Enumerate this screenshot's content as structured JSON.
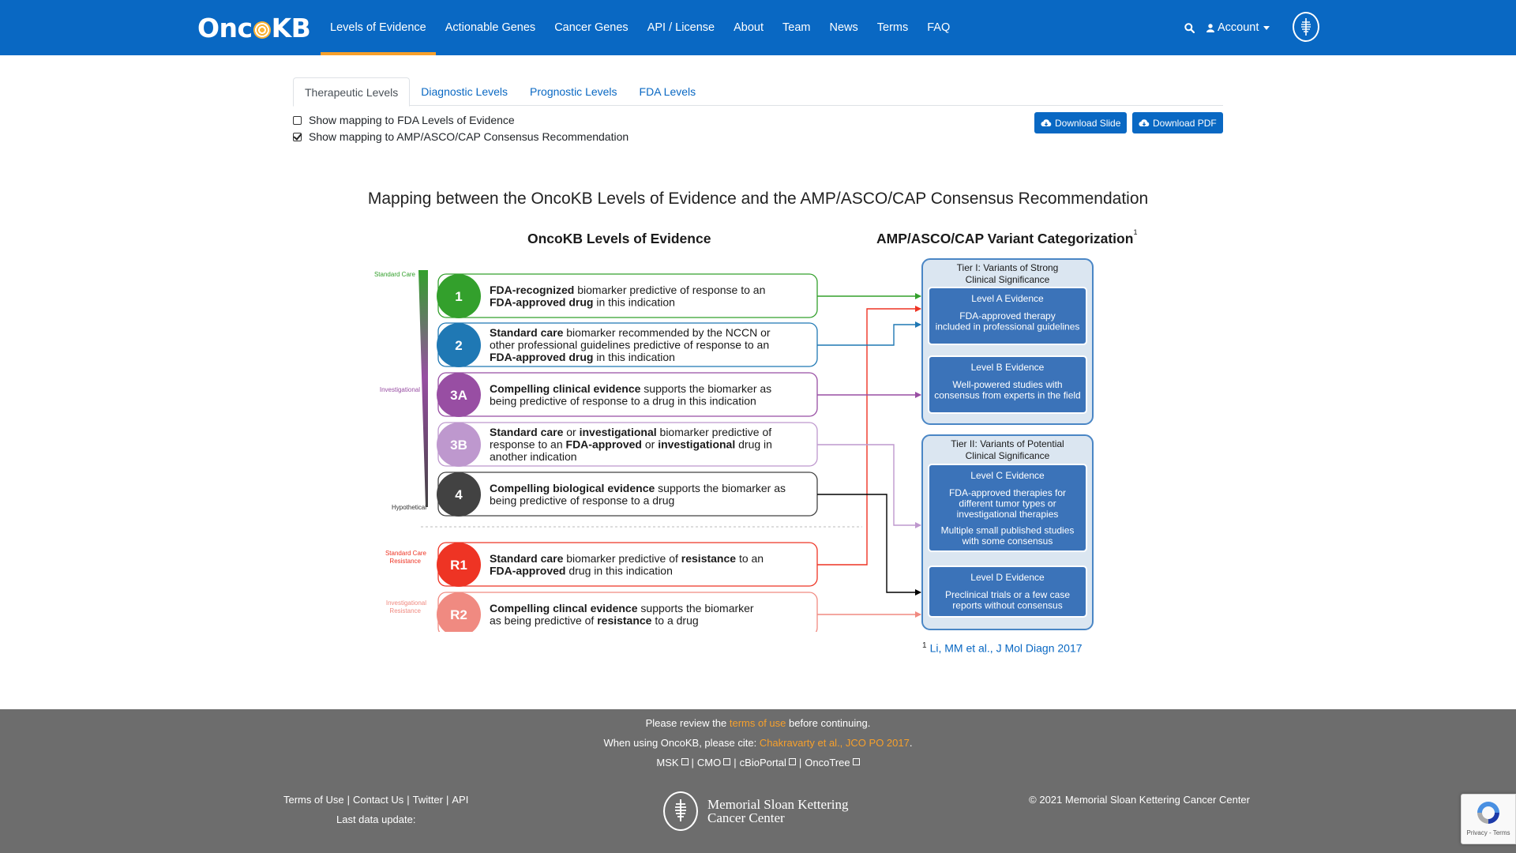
{
  "navbar": {
    "brand_left": "Onc",
    "brand_right": "KB",
    "links": [
      "Levels of Evidence",
      "Actionable Genes",
      "Cancer Genes",
      "API / License",
      "About",
      "Team",
      "News",
      "Terms",
      "FAQ"
    ],
    "account_label": "Account",
    "search_icon": "search-icon",
    "accent_color": "#0968c3",
    "active_underline_color": "#f7a02b"
  },
  "tabs": [
    "Therapeutic Levels",
    "Diagnostic Levels",
    "Prognostic Levels",
    "FDA Levels"
  ],
  "options": {
    "fda_mapping": {
      "label": "Show mapping to FDA Levels of Evidence",
      "checked": false
    },
    "amp_mapping": {
      "label": "Show mapping to AMP/ASCO/CAP Consensus Recommendation",
      "checked": true
    }
  },
  "buttons": {
    "download_slide": "Download Slide",
    "download_pdf": "Download PDF"
  },
  "figure": {
    "title": "Mapping between the OncoKB Levels of Evidence and the AMP/ASCO/CAP Consensus Recommendation",
    "left_heading": "OncoKB Levels of Evidence",
    "right_heading": "AMP/ASCO/CAP Variant Categorization",
    "right_heading_sup": "1",
    "scale_labels": {
      "standard_care": "Standard Care",
      "investigational": "Investigational",
      "hypothetical": "Hypothetical",
      "sc_resistance_1": "Standard Care",
      "sc_resistance_2": "Resistance",
      "inv_resistance_1": "Investigational",
      "inv_resistance_2": "Resistance"
    },
    "levels": [
      {
        "id": "1",
        "color": "#33a02c",
        "lines": [
          [
            [
              "FDA-recognized",
              true
            ],
            [
              " biomarker predictive of response to an",
              false
            ]
          ],
          [
            [
              "FDA-approved drug",
              true
            ],
            [
              " in this indication",
              false
            ]
          ]
        ]
      },
      {
        "id": "2",
        "color": "#1f78b4",
        "lines": [
          [
            [
              "Standard care",
              true
            ],
            [
              " biomarker recommended by the NCCN or",
              false
            ]
          ],
          [
            [
              "other professional guidelines predictive of response to an",
              false
            ]
          ],
          [
            [
              "FDA-approved drug",
              true
            ],
            [
              " in this indication",
              false
            ]
          ]
        ]
      },
      {
        "id": "3A",
        "color": "#984ea3",
        "lines": [
          [
            [
              "Compelling clinical evidence",
              true
            ],
            [
              " supports the biomarker as",
              false
            ]
          ],
          [
            [
              "being predictive of response to a drug in this indication",
              false
            ]
          ]
        ]
      },
      {
        "id": "3B",
        "color": "#be98ce",
        "lines": [
          [
            [
              "Standard care",
              true
            ],
            [
              " or ",
              false
            ],
            [
              "investigational",
              true
            ],
            [
              " biomarker predictive of",
              false
            ]
          ],
          [
            [
              "response to an ",
              false
            ],
            [
              "FDA-approved",
              true
            ],
            [
              " or ",
              false
            ],
            [
              "investigational",
              true
            ],
            [
              " drug in",
              false
            ]
          ],
          [
            [
              "another indication",
              false
            ]
          ]
        ]
      },
      {
        "id": "4",
        "color": "#424242",
        "lines": [
          [
            [
              "Compelling biological evidence",
              true
            ],
            [
              " supports the biomarker as",
              false
            ]
          ],
          [
            [
              "being predictive of response to a drug",
              false
            ]
          ]
        ]
      },
      {
        "id": "R1",
        "color": "#ee3424",
        "lines": [
          [
            [
              "Standard care",
              true
            ],
            [
              " biomarker predictive of ",
              false
            ],
            [
              "resistance",
              true
            ],
            [
              " to an",
              false
            ]
          ],
          [
            [
              "FDA-approved",
              true
            ],
            [
              " drug in this indication",
              false
            ]
          ]
        ]
      },
      {
        "id": "R2",
        "color": "#f08a81",
        "lines": [
          [
            [
              "Compelling clincal evidence",
              true
            ],
            [
              " supports the biomarker",
              false
            ]
          ],
          [
            [
              "as being predictive of ",
              false
            ],
            [
              "resistance",
              true
            ],
            [
              " to a drug",
              false
            ]
          ]
        ]
      }
    ],
    "tiers": [
      {
        "title": [
          "Tier I: Variants of Strong",
          "Clinical Significance"
        ],
        "boxes": [
          {
            "title": "Level A Evidence",
            "lines": [
              "FDA-approved therapy",
              "included in professional guidelines"
            ]
          },
          {
            "title": "Level B Evidence",
            "lines": [
              "Well-powered studies with",
              "consensus from experts in the field"
            ]
          }
        ]
      },
      {
        "title": [
          "Tier II: Variants of Potential",
          "Clinical Significance"
        ],
        "boxes": [
          {
            "title": "Level C Evidence",
            "lines": [
              "FDA-approved therapies for",
              "different tumor types or",
              "investigational therapies",
              "",
              "Multiple small published studies",
              "with some consensus"
            ]
          },
          {
            "title": "Level D Evidence",
            "lines": [
              "Preclinical trials or a few case",
              "reports without consensus"
            ]
          }
        ]
      }
    ],
    "footnote_sup": "1",
    "footnote_text": "Li, MM et al., J Mol Diagn 2017"
  },
  "footer": {
    "review_prefix": "Please review the ",
    "review_link": "terms of use",
    "review_suffix": " before continuing.",
    "cite_prefix": "When using OncoKB, please cite: ",
    "cite_link": "Chakravarty et al., JCO PO 2017",
    "cite_suffix": ".",
    "ext_links": [
      "MSK",
      "CMO",
      "cBioPortal",
      "OncoTree"
    ],
    "left_links": [
      "Terms of Use",
      "Contact Us",
      "Twitter",
      "API"
    ],
    "last_update": "Last data update:",
    "msk_name_1": "Memorial Sloan Kettering",
    "msk_name_2": "Cancer Center",
    "copyright": "© 2021 Memorial Sloan Kettering Cancer Center"
  },
  "recaptcha": {
    "text": "Privacy - Terms"
  }
}
